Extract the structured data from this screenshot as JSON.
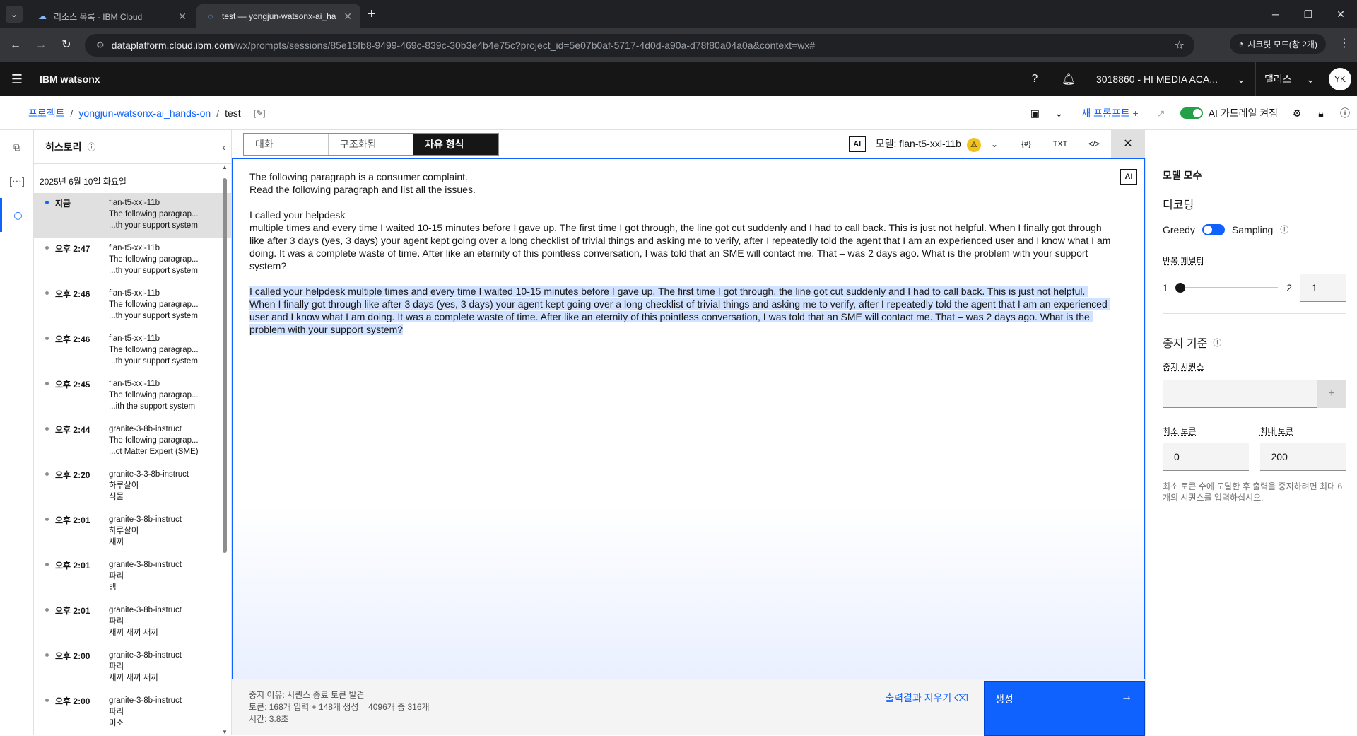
{
  "browser": {
    "tabs": [
      {
        "title": "리소스 목록 - IBM Cloud"
      },
      {
        "title": "test — yongjun-watsonx-ai_ha"
      }
    ],
    "url_domain": "dataplatform.cloud.ibm.com",
    "url_rest": "/wx/prompts/sessions/85e15fb8-9499-469c-839c-30b3e4b4e75c?project_id=5e07b0af-5717-4d0d-a90a-d78f80a04a0a&context=wx#",
    "incognito": "시크릿 모드(창 2개)"
  },
  "header": {
    "brand": "IBM watsonx",
    "account": "3018860 - HI MEDIA ACA...",
    "region": "댈러스",
    "avatar": "YK"
  },
  "breadcrumb": {
    "project": "프로젝트",
    "sep1": "/",
    "folder": "yongjun-watsonx-ai_hands-on",
    "sep2": "/",
    "current": "test"
  },
  "toolbar": {
    "new_prompt": "새 프롬프트",
    "guardrail": "AI 가드레일 켜짐"
  },
  "history": {
    "title": "히스토리",
    "date": "2025년 6월 10일 화요일",
    "items": [
      {
        "time": "지금",
        "l1": "flan-t5-xxl-11b",
        "l2": "The following paragrap...",
        "l3": "...th your support system"
      },
      {
        "time": "오후 2:47",
        "l1": "flan-t5-xxl-11b",
        "l2": "The following paragrap...",
        "l3": "...th your support system"
      },
      {
        "time": "오후 2:46",
        "l1": "flan-t5-xxl-11b",
        "l2": "The following paragrap...",
        "l3": "...th your support system"
      },
      {
        "time": "오후 2:46",
        "l1": "flan-t5-xxl-11b",
        "l2": "The following paragrap...",
        "l3": "...th your support system"
      },
      {
        "time": "오후 2:45",
        "l1": "flan-t5-xxl-11b",
        "l2": "The following paragrap...",
        "l3": "...ith the support system"
      },
      {
        "time": "오후 2:44",
        "l1": "granite-3-8b-instruct",
        "l2": "The following paragrap...",
        "l3": "...ct Matter Expert (SME)"
      },
      {
        "time": "오후 2:20",
        "l1": "granite-3-3-8b-instruct",
        "l2": "하루살이",
        "l3": "식물"
      },
      {
        "time": "오후 2:01",
        "l1": "granite-3-8b-instruct",
        "l2": "하루살이",
        "l3": "새끼"
      },
      {
        "time": "오후 2:01",
        "l1": "granite-3-8b-instruct",
        "l2": "파리",
        "l3": "뱀"
      },
      {
        "time": "오후 2:01",
        "l1": "granite-3-8b-instruct",
        "l2": "파리",
        "l3": "새끼 새끼 새끼"
      },
      {
        "time": "오후 2:00",
        "l1": "granite-3-8b-instruct",
        "l2": "파리",
        "l3": "새끼 새끼 새끼"
      },
      {
        "time": "오후 2:00",
        "l1": "granite-3-8b-instruct",
        "l2": "파리",
        "l3": "미소"
      }
    ]
  },
  "modes": {
    "chat": "대화",
    "structured": "구조화됨",
    "freeform": "자유 형식"
  },
  "model": {
    "ai_badge": "AI",
    "label": "모델: flan-t5-xxl-11b",
    "icon1": "{#}",
    "icon2": "TXT",
    "icon3": "</>"
  },
  "prompt": {
    "line1": "The following paragraph is a consumer complaint.",
    "line2": "Read the following paragraph and list all the issues.",
    "line3": "I called your helpdesk",
    "para": "multiple times and every time I waited 10-15 minutes before I gave up. The first time I got through, the line got cut suddenly and I had to call back. This is just not helpful. When I finally got through like after 3 days (yes, 3 days) your agent kept going over a long checklist of trivial things and asking me to verify, after I repeatedly told the agent that I am an experienced user and I know what I am doing. It was a complete waste of time. After like an eternity of this pointless conversation, I was told that an SME will contact me. That – was 2 days ago. What is the problem with your support system?",
    "output": "I called your helpdesk multiple times and every time I waited 10-15 minutes before I gave up. The first time I got through, the line got cut suddenly and I had to call back. This is just not helpful. When I finally got through like after 3 days (yes, 3 days) your agent kept going over a long checklist of trivial things and asking me to verify, after I repeatedly told the agent that I am an experienced user and I know what I am doing. It was a complete waste of time. After like an eternity of this pointless conversation, I was told that an SME will contact me. That – was 2 days ago. What is the problem with your support system?"
  },
  "footer": {
    "stop_reason": "중지 이유: 시퀀스 종료 토큰 발견",
    "tokens": "토큰: 168개 입력 + 148개 생성 = 4096개 중 316개",
    "time": "시간: 3.8초",
    "clear": "출력결과 지우기",
    "generate": "생성"
  },
  "params": {
    "title": "모델 모수",
    "decoding": "디코딩",
    "greedy": "Greedy",
    "sampling": "Sampling",
    "rep_penalty": "반복 페널티",
    "rep_min": "1",
    "rep_max": "2",
    "rep_value": "1",
    "stop_criteria": "중지 기준",
    "stop_seq": "중지 시퀀스",
    "min_tokens_label": "최소 토큰",
    "max_tokens_label": "최대 토큰",
    "min_tokens": "0",
    "max_tokens": "200",
    "helper": "최소 토큰 수에 도달한 후 출력을 중지하려면 최대 6개의 시퀀스를 입력하십시오."
  }
}
